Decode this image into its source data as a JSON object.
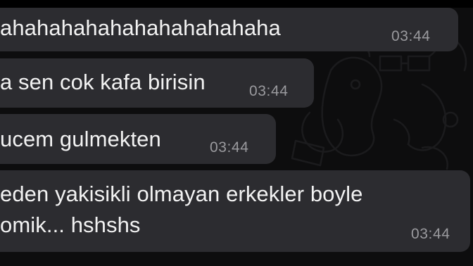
{
  "chat": {
    "messages": [
      {
        "text": "ahahahahahahahahahahaha",
        "time": "03:44"
      },
      {
        "text": "a sen cok kafa birisin",
        "time": "03:44"
      },
      {
        "text": "ucem gulmekten",
        "time": "03:44"
      },
      {
        "text_lines": [
          "eden yakisikli olmayan erkekler boyle",
          "omik... hshshs"
        ],
        "time": "03:44"
      }
    ]
  },
  "colors": {
    "background": "#0d0d0e",
    "bubble": "#2c2c30",
    "text": "#f2f2f2",
    "timestamp": "#9a9a9e"
  }
}
